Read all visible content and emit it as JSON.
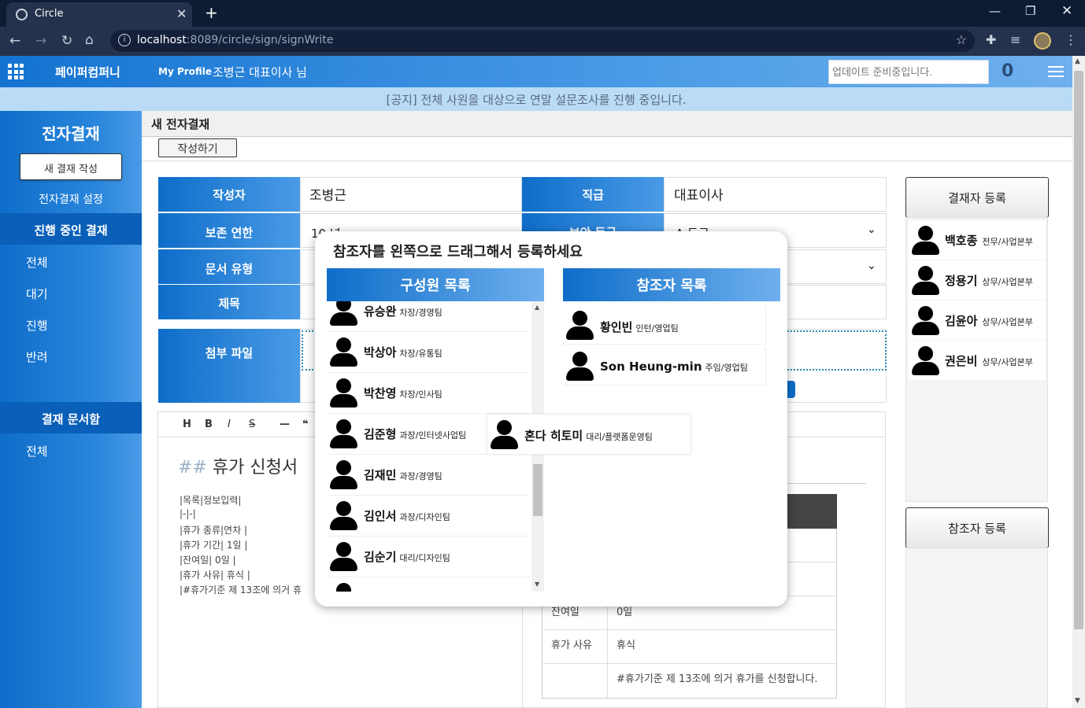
{
  "browser": {
    "tab_title": "Circle",
    "url_host": "localhost",
    "url_path": ":8089/circle/sign/signWrite"
  },
  "header": {
    "company": "페이퍼컴퍼니",
    "my_profile": "My Profile",
    "user": "조병근 대표이사 님",
    "search_placeholder": "업데이트 준비중입니다.",
    "count": "0"
  },
  "notice": "[공지] 전체 사원을 대상으로 연말 설문조사를 진행 중입니다.",
  "sidebar": {
    "title": "전자결재",
    "new_button": "새 결재 작성",
    "settings": "전자결재 설정",
    "section1": "진행 중인 결재",
    "items1": [
      "전체",
      "대기",
      "진행",
      "반려"
    ],
    "section2": "결재 문서함",
    "items2": [
      "전체"
    ]
  },
  "page": {
    "title": "새 전자결재",
    "write_button": "작성하기"
  },
  "form": {
    "author_label": "작성자",
    "author": "조병근",
    "position_label": "직급",
    "position": "대표이사",
    "retention_label": "보존 연한",
    "retention": "10 년",
    "security_label": "보안 등급",
    "security": "A 등급",
    "doctype_label": "문서 유형",
    "subject_label": "제목",
    "attach_label": "첨부 파일"
  },
  "editor": {
    "toolbar": [
      "H",
      "B",
      "I",
      "S",
      "—",
      "❝"
    ],
    "heading_mark": "##",
    "heading": "휴가 신청서",
    "lines": [
      "|목록|정보입력|",
      "|-|-|",
      "|휴가 종류|연차 |",
      "|휴가 기간| 1일 |",
      "|잔여일| 0일 |",
      "|휴가 사유| 휴식 |",
      "|#휴가기준 제 13조에 의거 휴"
    ],
    "preview_rows": [
      {
        "k": "잔여일",
        "v": "0일"
      },
      {
        "k": "휴가 사유",
        "v": "휴식"
      },
      {
        "k": "",
        "v": "#휴가기준 제 13조에 의거 휴가를 신청합니다."
      }
    ]
  },
  "right": {
    "approver_button": "결재자 등록",
    "approvers": [
      {
        "name": "백호종",
        "dept": "전무/사업본부"
      },
      {
        "name": "정용기",
        "dept": "상무/사업본부"
      },
      {
        "name": "김윤아",
        "dept": "상무/사업본부"
      },
      {
        "name": "권은비",
        "dept": "상무/사업본부"
      }
    ],
    "referrer_button": "참조자 등록"
  },
  "modal": {
    "title": "참조자를 왼쪽으로 드래그해서 등록하세요",
    "members_header": "구성원 목록",
    "referrers_header": "참조자 목록",
    "members": [
      {
        "name": "유승완",
        "dept": "차장/경영팀"
      },
      {
        "name": "박상아",
        "dept": "차장/유통팀"
      },
      {
        "name": "박찬영",
        "dept": "차장/인사팀"
      },
      {
        "name": "김준형",
        "dept": "과장/인터넷사업팀"
      },
      {
        "name": "김재민",
        "dept": "과장/경영팀"
      },
      {
        "name": "김인서",
        "dept": "과장/디자인팀"
      },
      {
        "name": "김순기",
        "dept": "대리/디자인팀"
      }
    ],
    "referrers": [
      {
        "name": "황인빈",
        "dept": "인턴/영업팀"
      },
      {
        "name": "Son Heung-min",
        "dept": "주임/영업팀"
      }
    ],
    "dragging": {
      "name": "혼다 히토미",
      "dept": "대리/플랫폼운영팀"
    }
  }
}
